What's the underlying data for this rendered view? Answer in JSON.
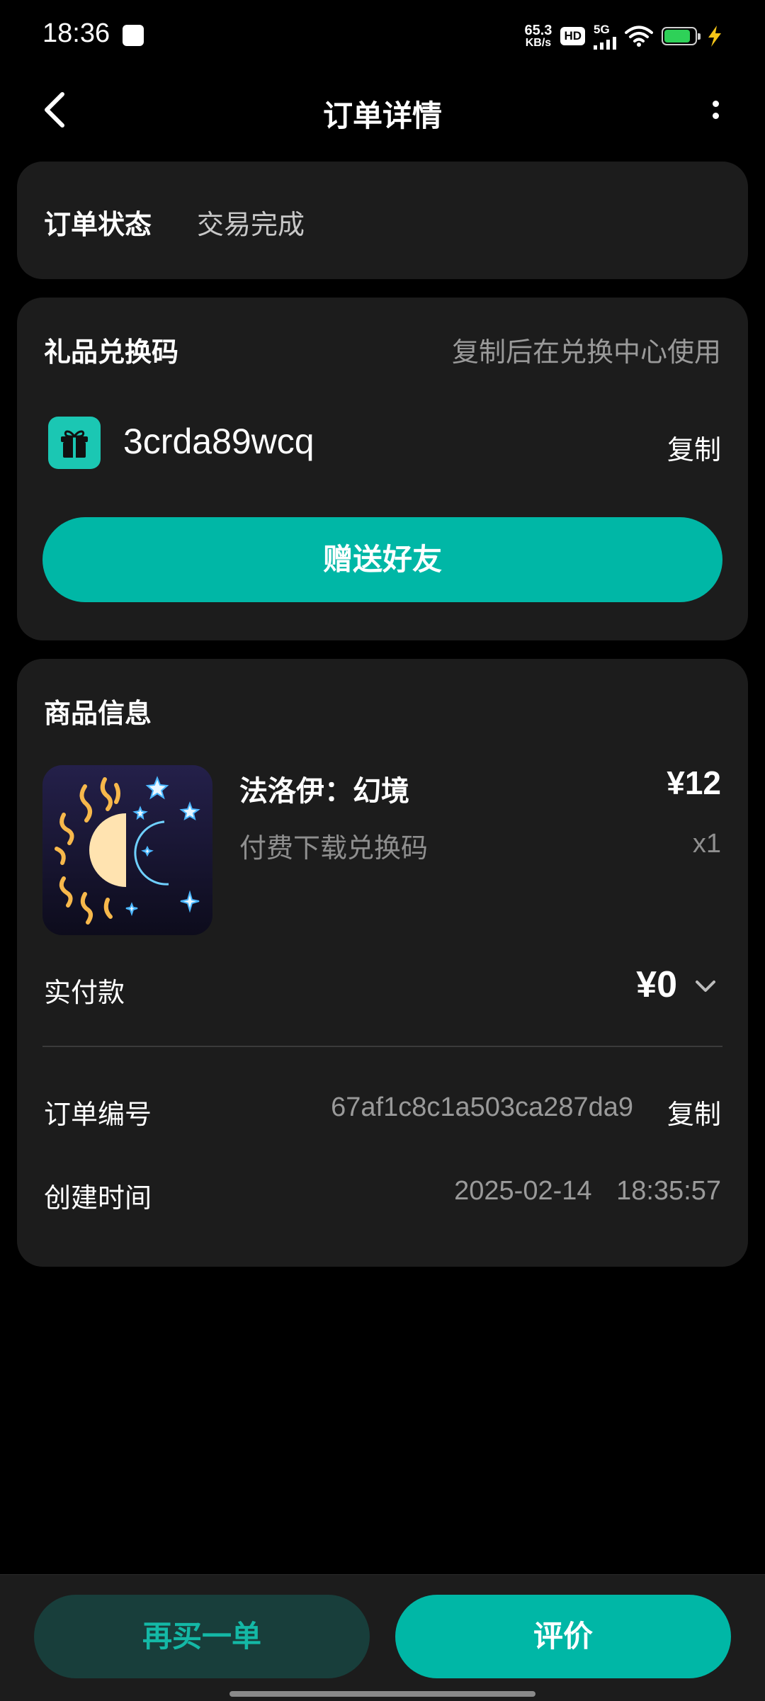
{
  "status_bar": {
    "time": "18:36",
    "net_speed_value": "65.3",
    "net_speed_unit": "KB/s",
    "hd": "HD",
    "network": "5G",
    "battery_level": 0.85,
    "battery_color": "#2ed158"
  },
  "header": {
    "title": "订单详情",
    "back_icon": "chevron-left-icon",
    "more_icon": "more-vertical-icon"
  },
  "order_status": {
    "label": "订单状态",
    "value": "交易完成"
  },
  "gift_code": {
    "title": "礼品兑换码",
    "hint": "复制后在兑换中心使用",
    "icon": "gift-icon",
    "code": "3crda89wcq",
    "copy_label": "复制",
    "send_label": "赠送好友"
  },
  "product": {
    "section_title": "商品信息",
    "name": "法洛伊：幻境",
    "subtitle": "付费下载兑换码",
    "price": "¥12",
    "quantity": "x1",
    "thumbnail_icon": "sun-moon-game-icon",
    "paid_label": "实付款",
    "paid_value": "¥0",
    "order_no_label": "订单编号",
    "order_no_value": "67af1c8c1a503ca287da9",
    "order_no_copy": "复制",
    "created_label": "创建时间",
    "created_value": "2025-02-14 18:35:57"
  },
  "bottom_bar": {
    "buy_again_label": "再买一单",
    "review_label": "评价"
  },
  "colors": {
    "accent": "#00b7a6",
    "card_bg": "#1c1c1c",
    "page_bg": "#000000"
  }
}
